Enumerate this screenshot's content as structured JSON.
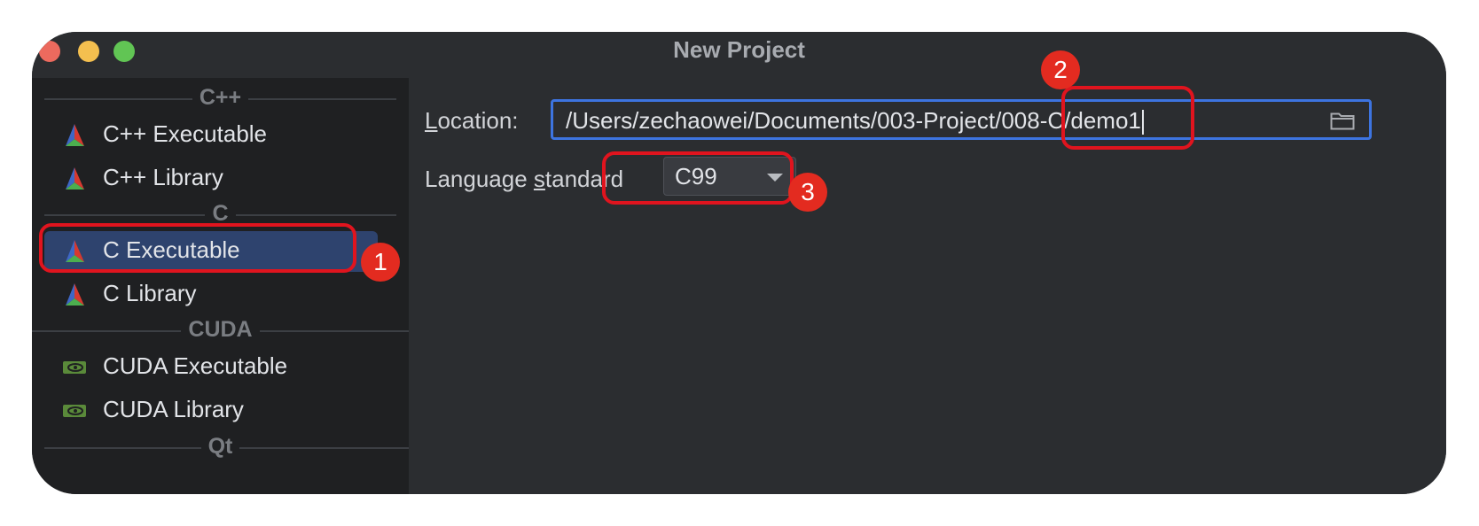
{
  "window": {
    "title": "New Project"
  },
  "sidebar": {
    "groups": [
      {
        "header": "C++",
        "items": [
          {
            "label": "C++ Executable",
            "icon": "cmake-icon"
          },
          {
            "label": "C++ Library",
            "icon": "cmake-icon"
          }
        ]
      },
      {
        "header": "C",
        "items": [
          {
            "label": "C Executable",
            "icon": "cmake-icon",
            "selected": true
          },
          {
            "label": "C Library",
            "icon": "cmake-icon"
          }
        ]
      },
      {
        "header": "CUDA",
        "items": [
          {
            "label": "CUDA Executable",
            "icon": "nvidia-icon"
          },
          {
            "label": "CUDA Library",
            "icon": "nvidia-icon"
          }
        ]
      },
      {
        "header": "Qt",
        "items": []
      }
    ]
  },
  "form": {
    "location": {
      "label_prefix": "",
      "label_mnemonic": "L",
      "label_rest": "ocation:",
      "value": "/Users/zechaowei/Documents/003-Project/008-C/demo1",
      "folder_icon": "folder-icon"
    },
    "language_standard": {
      "label_prefix": "Language ",
      "label_mnemonic": "s",
      "label_rest": "tandard",
      "value": "C99"
    }
  },
  "annotations": {
    "badge_1": "1",
    "badge_2": "2",
    "badge_3": "3",
    "color": "#e0141e"
  }
}
